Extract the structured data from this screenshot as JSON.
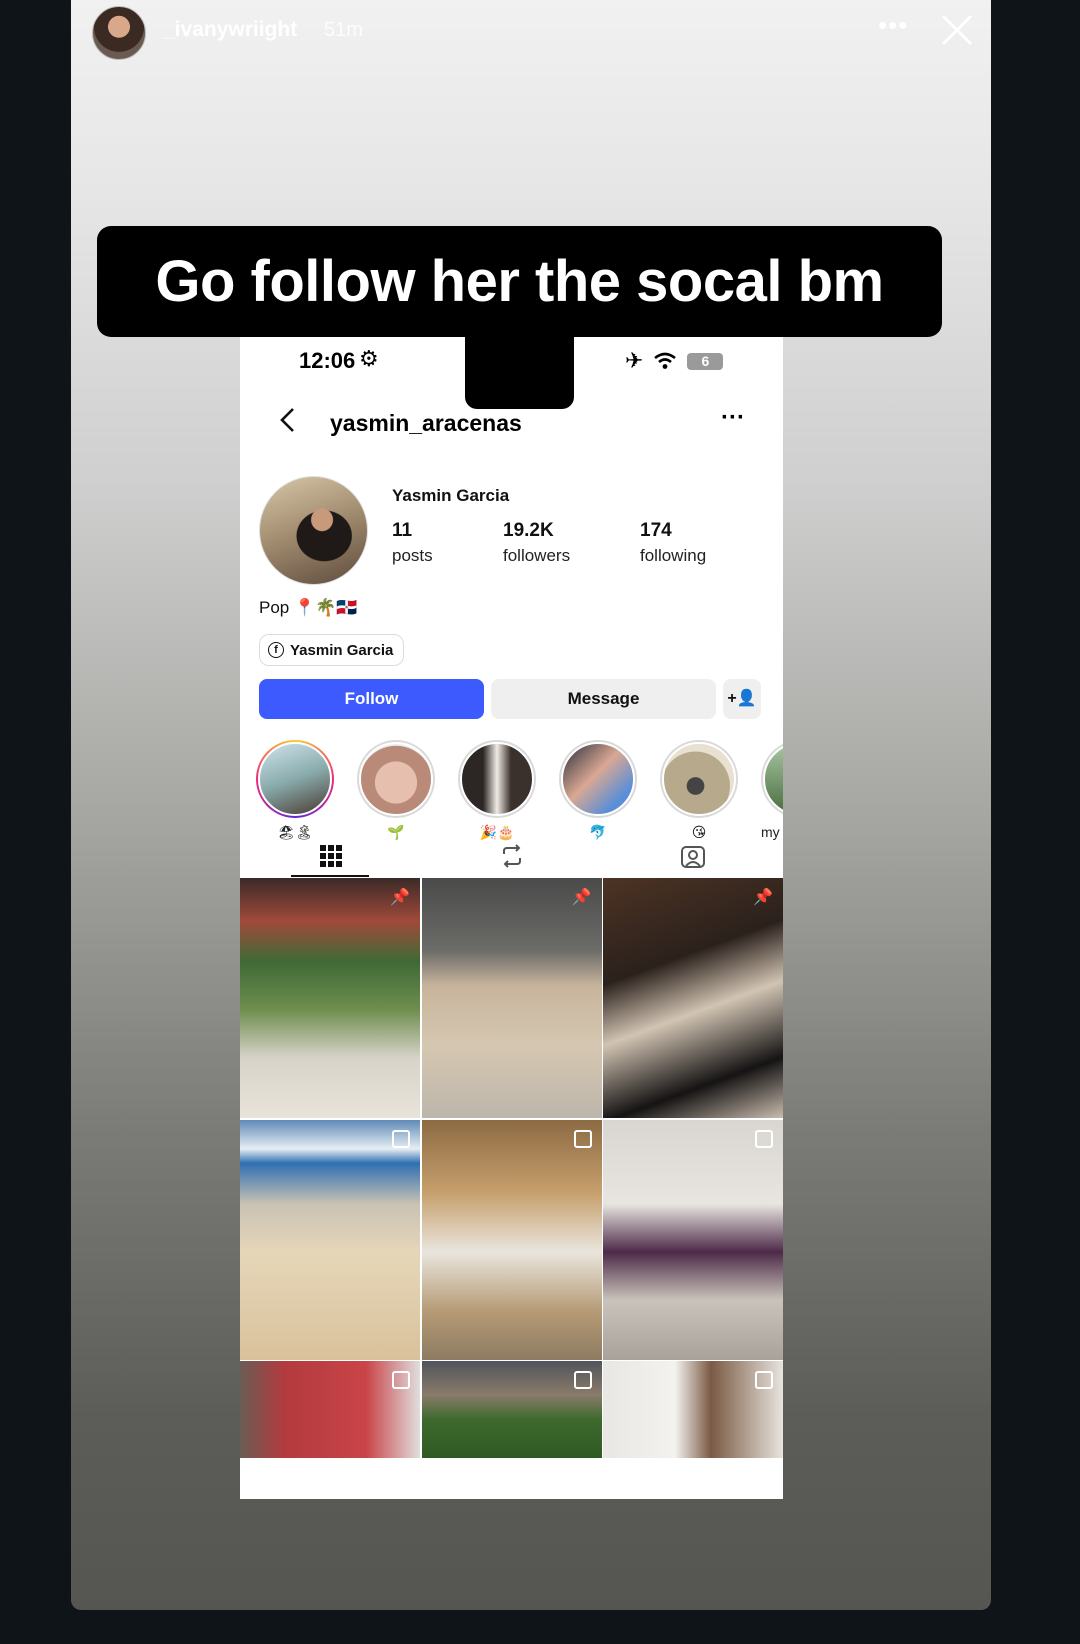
{
  "story": {
    "username": "_ivanywriight",
    "time_ago": "51m",
    "more_glyph": "•••",
    "caption": "Go follow her the socal bm",
    "caption_emoji": "😂"
  },
  "embedded_screenshot": {
    "status_bar": {
      "time": "12:06",
      "gear_glyph": "⚙",
      "battery": "6"
    },
    "profile": {
      "username": "yasmin_aracenas",
      "display_name": "Yasmin Garcia",
      "stats": [
        {
          "value": "11",
          "label": "posts"
        },
        {
          "value": "19.2K",
          "label": "followers"
        },
        {
          "value": "174",
          "label": "following"
        }
      ],
      "bio": "Pop 📍🌴🇩🇴",
      "facebook_link": "Yasmin Garcia",
      "follow_button": "Follow",
      "message_button": "Message",
      "add_user_glyph": "+👤"
    },
    "highlights": [
      {
        "label": "🏖🏝"
      },
      {
        "label": "🌱"
      },
      {
        "label": "🎉🎂"
      },
      {
        "label": "🐬"
      },
      {
        "label": "😘"
      },
      {
        "label": "my l"
      }
    ],
    "tabs": [
      "posts-grid",
      "reposts",
      "tagged"
    ]
  }
}
